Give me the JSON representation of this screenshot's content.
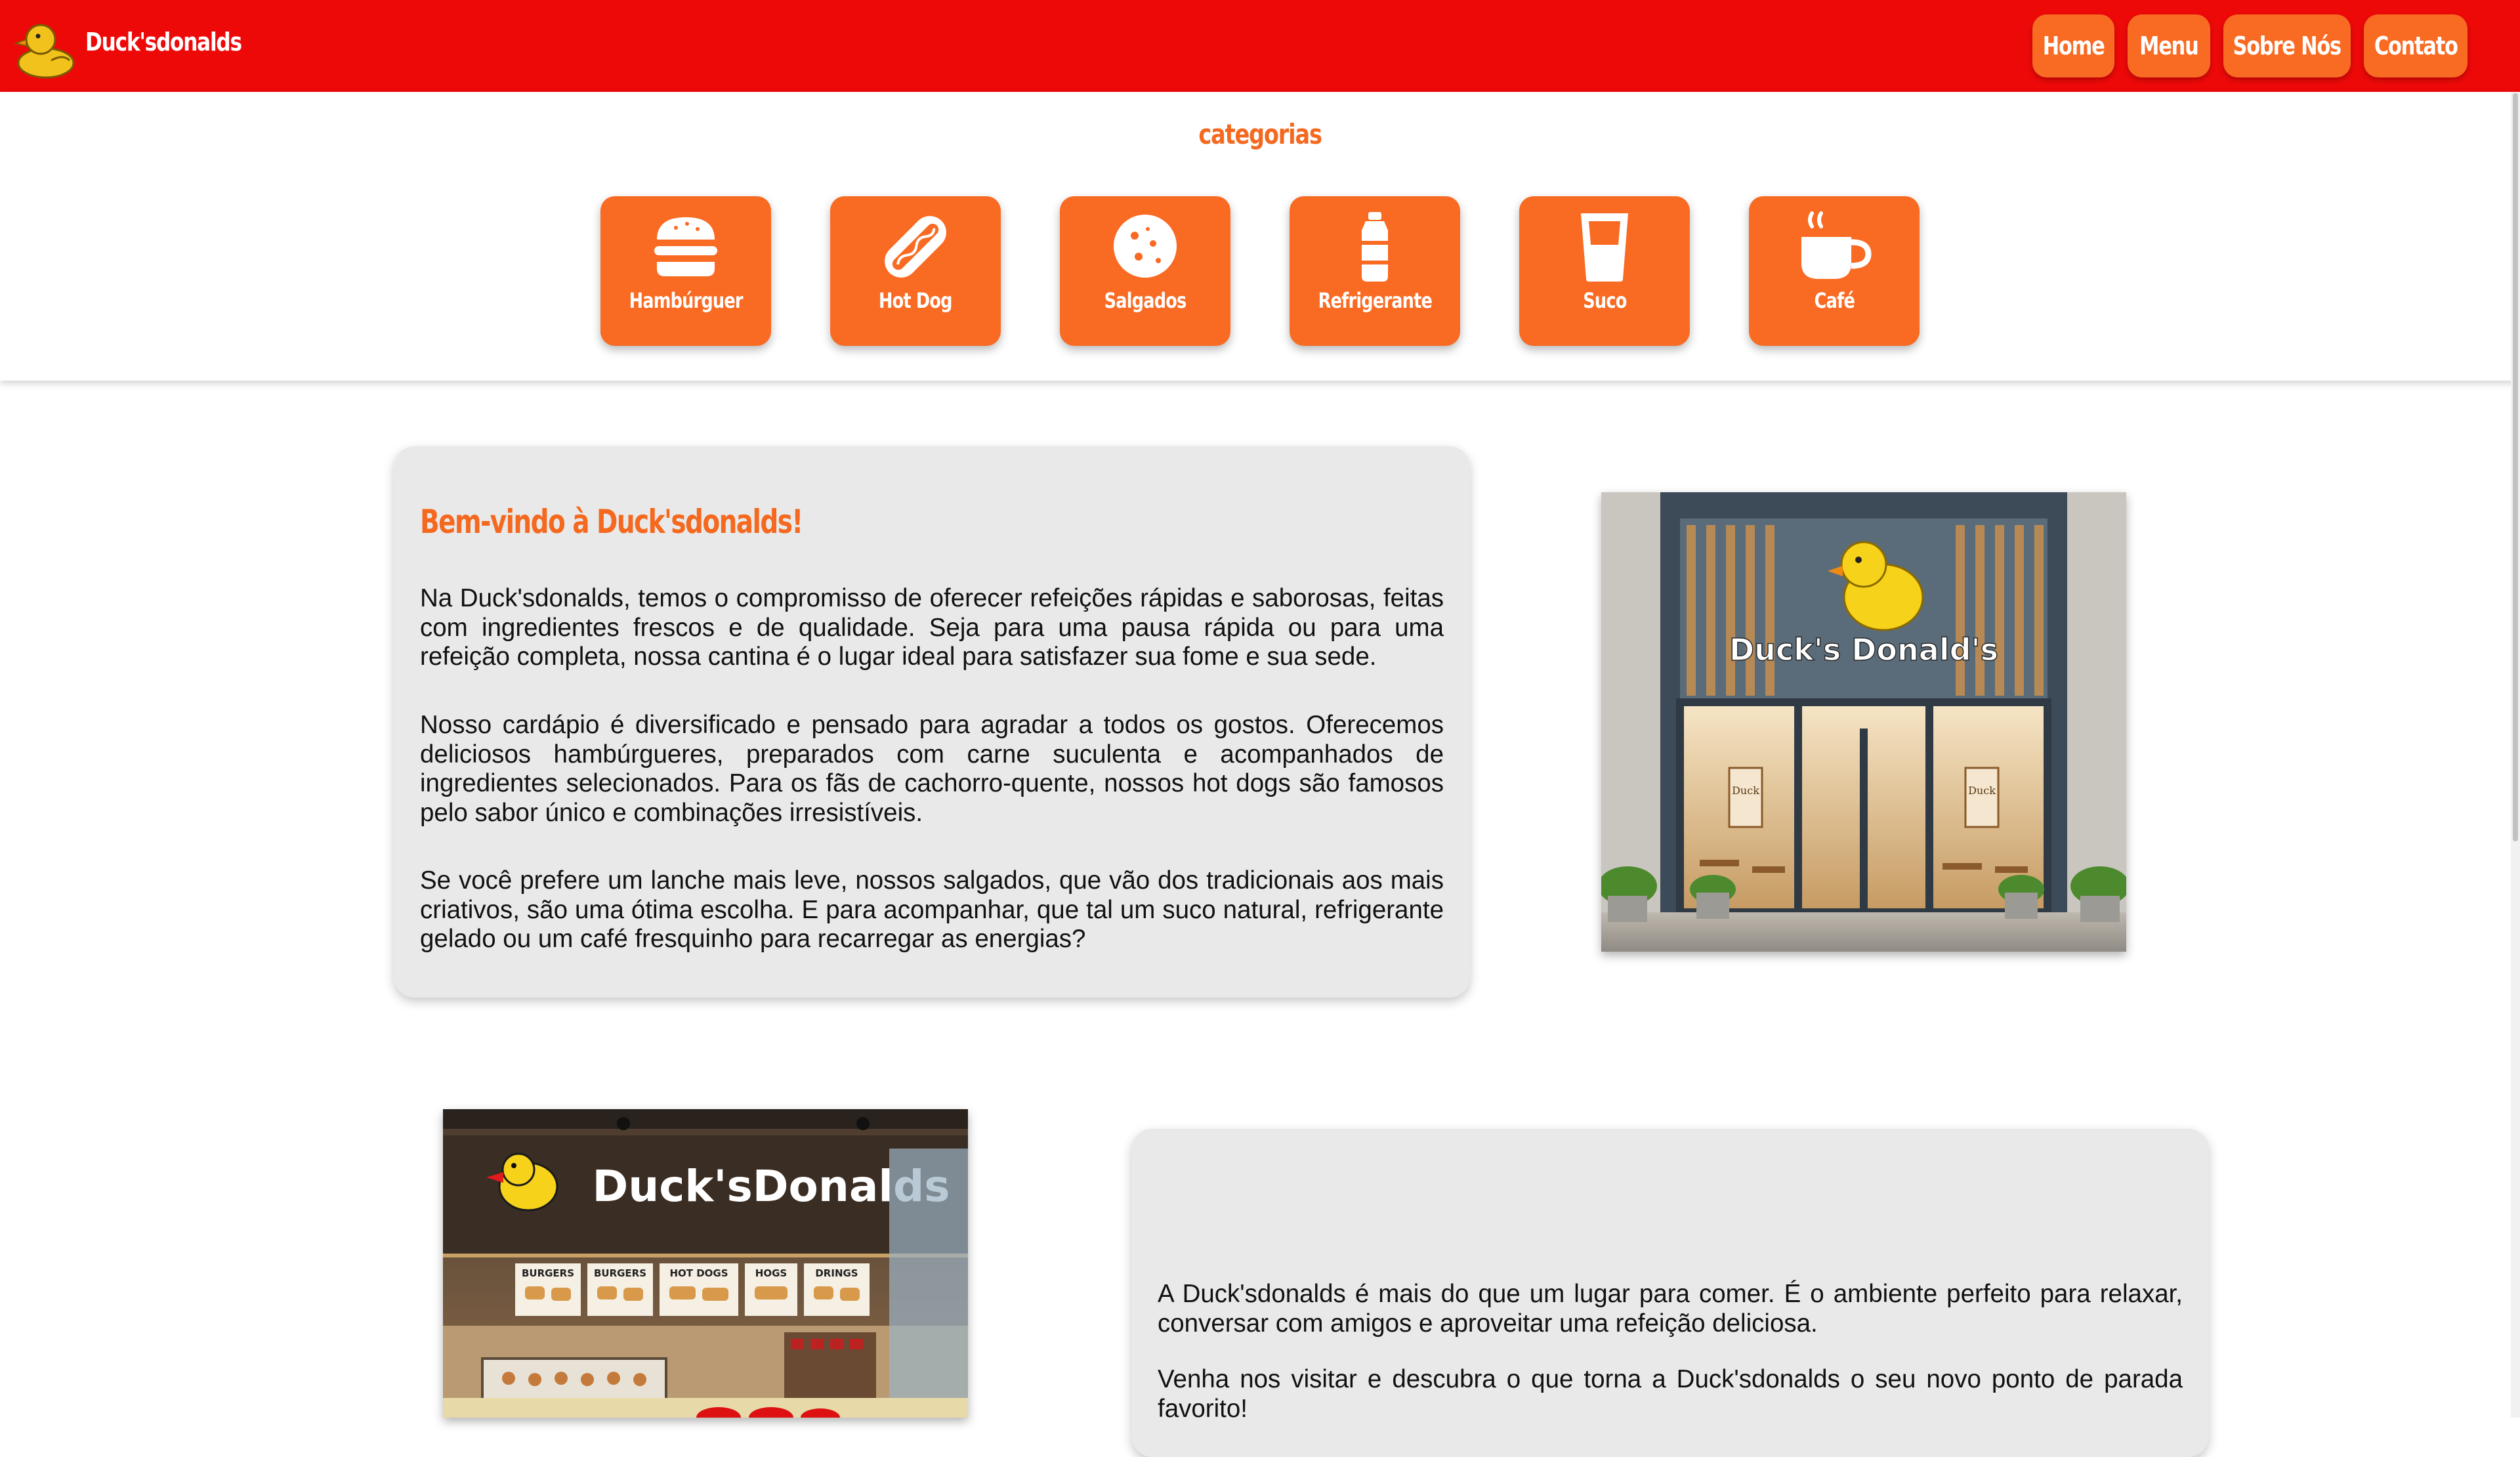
{
  "header": {
    "brand": "Duck'sdonalds",
    "nav": [
      "Home",
      "Menu",
      "Sobre Nós",
      "Contato"
    ]
  },
  "categories": {
    "title": "categorias",
    "items": [
      {
        "label": "Hambúrguer",
        "icon": "hamburger-icon"
      },
      {
        "label": "Hot Dog",
        "icon": "hotdog-icon"
      },
      {
        "label": "Salgados",
        "icon": "cookie-icon"
      },
      {
        "label": "Refrigerante",
        "icon": "bottle-icon"
      },
      {
        "label": "Suco",
        "icon": "glass-icon"
      },
      {
        "label": "Café",
        "icon": "coffee-icon"
      }
    ]
  },
  "welcome": {
    "heading": "Bem-vindo à Duck'sdonalds!",
    "paragraphs": [
      "Na Duck'sdonalds, temos o compromisso de oferecer refeições rápidas e saborosas, feitas com ingredientes frescos e de qualidade. Seja para uma pausa rápida ou para uma refeição completa, nossa cantina é o lugar ideal para satisfazer sua fome e sua sede.",
      "Nosso cardápio é diversificado e pensado para agradar a todos os gostos. Oferecemos deliciosos hambúrgueres, preparados com carne suculenta e acompanhados de ingredientes selecionados. Para os fãs de cachorro-quente, nossos hot dogs são famosos pelo sabor único e combinações irresistíveis.",
      "Se você prefere um lanche mais leve, nossos salgados, que vão dos tradicionais aos mais criativos, são uma ótima escolha. E para acompanhar, que tal um suco natural, refrigerante gelado ou um café fresquinho para recarregar as energias?"
    ]
  },
  "about": {
    "paragraphs": [
      "A Duck'sdonalds é mais do que um lugar para comer. É o ambiente perfeito para relaxar, conversar com amigos e aproveitar uma refeição deliciosa.",
      "Venha nos visitar e descubra o que torna a Duck'sdonalds o seu novo ponto de parada favorito!"
    ]
  },
  "images": {
    "storefront_sign": "Duck's Donald's",
    "interior_sign": "Duck'sDonalds",
    "menu_boards": [
      "BURGERS",
      "BURGERS",
      "HOT DOGS",
      "HOGS",
      "DRINGS"
    ],
    "window_posters": [
      "Duck",
      "Duck"
    ]
  },
  "colors": {
    "header": "#ee0909",
    "accent": "#f96a22",
    "heading_text": "#f4691f",
    "card_bg": "#e9e9e9"
  }
}
